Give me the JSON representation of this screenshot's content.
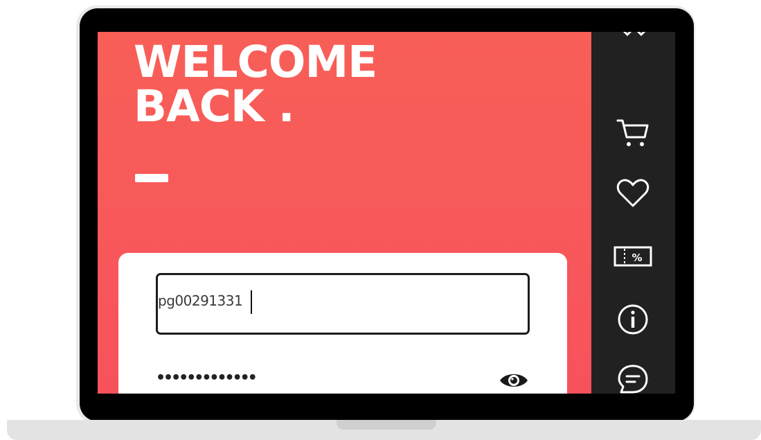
{
  "hero": {
    "title_line1": "WELCOME",
    "title_line2": "BACK .",
    "background": "#f85a58"
  },
  "login": {
    "username_value": "pg00291331",
    "password_mask": "•••••••••••••"
  },
  "sidebar": {
    "items": [
      "cart-icon",
      "heart-icon",
      "coupon-icon",
      "info-icon",
      "chat-icon"
    ],
    "background": "#212121"
  }
}
